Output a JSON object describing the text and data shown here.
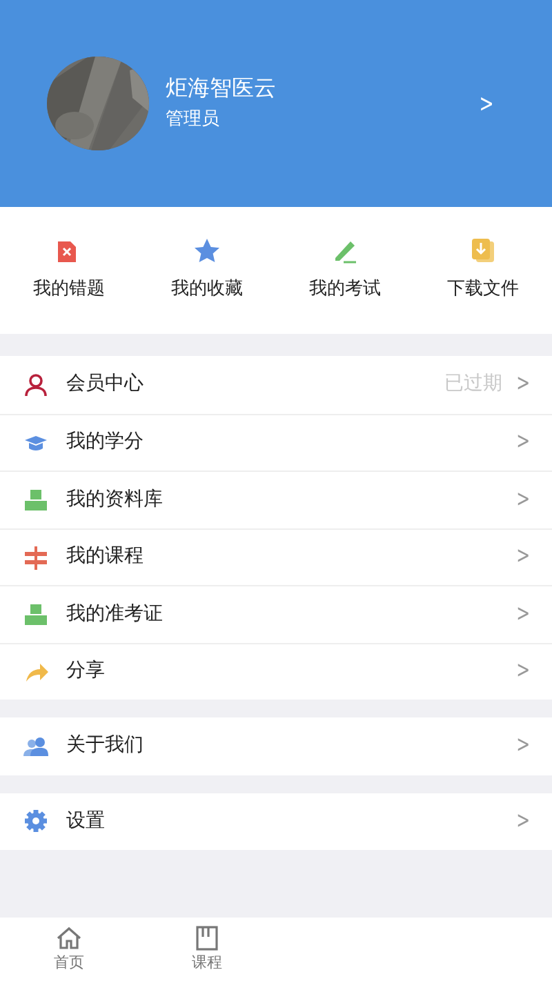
{
  "profile": {
    "name": "炬海智医云",
    "role": "管理员",
    "chevron": ">"
  },
  "shortcuts": [
    {
      "label": "我的错题"
    },
    {
      "label": "我的收藏"
    },
    {
      "label": "我的考试"
    },
    {
      "label": "下载文件"
    }
  ],
  "menu_groups": [
    [
      {
        "label": "会员中心",
        "status": "已过期",
        "chevron": ">"
      },
      {
        "label": "我的学分",
        "chevron": ">"
      },
      {
        "label": "我的资料库",
        "chevron": ">"
      },
      {
        "label": "我的课程",
        "chevron": ">"
      },
      {
        "label": "我的准考证",
        "chevron": ">"
      },
      {
        "label": "分享",
        "chevron": ">"
      }
    ],
    [
      {
        "label": "关于我们",
        "chevron": ">"
      }
    ],
    [
      {
        "label": "设置",
        "chevron": ">"
      }
    ]
  ],
  "tab_bar": [
    {
      "label": "首页",
      "selected": false
    },
    {
      "label": "课程",
      "selected": false
    }
  ]
}
